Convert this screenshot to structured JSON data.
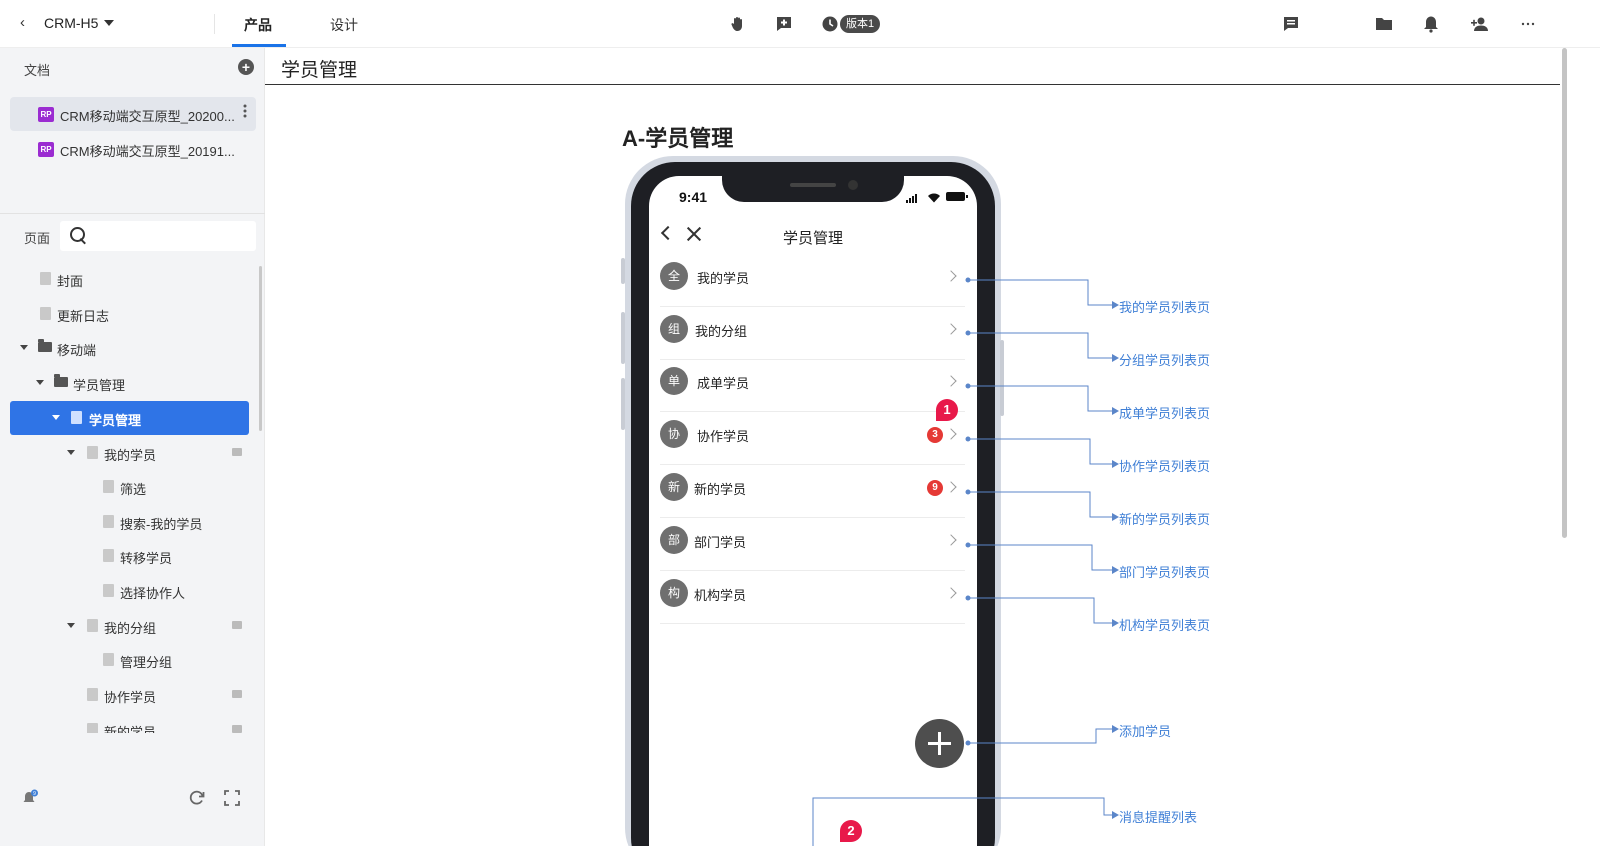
{
  "topbar": {
    "project_name": "CRM-H5",
    "tabs": [
      {
        "label": "产品"
      },
      {
        "label": "设计"
      }
    ],
    "version_badge": "版本1"
  },
  "sidebar": {
    "docs_label": "文档",
    "docs": [
      {
        "badge": "RP",
        "name": "CRM移动端交互原型_20200..."
      },
      {
        "badge": "RP",
        "name": "CRM移动端交互原型_20191..."
      }
    ],
    "pages_label": "页面",
    "search_placeholder": "",
    "tree": [
      {
        "label": "封面"
      },
      {
        "label": "更新日志"
      },
      {
        "label": "移动端"
      },
      {
        "label": "学员管理"
      },
      {
        "label": "学员管理"
      },
      {
        "label": "我的学员"
      },
      {
        "label": "筛选"
      },
      {
        "label": "搜索-我的学员"
      },
      {
        "label": "转移学员"
      },
      {
        "label": "选择协作人"
      },
      {
        "label": "我的分组"
      },
      {
        "label": "管理分组"
      },
      {
        "label": "协作学员"
      },
      {
        "label": "新的学员"
      }
    ],
    "notify_count": "9"
  },
  "canvas": {
    "page_title": "学员管理",
    "section_title": "A-学员管理",
    "phone": {
      "status_time": "9:41",
      "nav_title": "学员管理",
      "menu": [
        {
          "icon_char": "全",
          "label": "我的学员",
          "count": ""
        },
        {
          "icon_char": "组",
          "label": "我的分组",
          "count": ""
        },
        {
          "icon_char": "单",
          "label": "成单学员",
          "count": ""
        },
        {
          "icon_char": "协",
          "label": "协作学员",
          "count": "3"
        },
        {
          "icon_char": "新",
          "label": "新的学员",
          "count": "9"
        },
        {
          "icon_char": "部",
          "label": "部门学员",
          "count": ""
        },
        {
          "icon_char": "构",
          "label": "机构学员",
          "count": ""
        }
      ],
      "markers": [
        "1",
        "2"
      ]
    },
    "link_targets": [
      "我的学员列表页",
      "分组学员列表页",
      "成单学员列表页",
      "协作学员列表页",
      "新的学员列表页",
      "部门学员列表页",
      "机构学员列表页",
      "添加学员",
      "消息提醒列表"
    ]
  },
  "colors": {
    "accent": "#2f74e6",
    "link": "#3f7fd6",
    "badge_red": "#e53935",
    "marker": "#e8194a",
    "rp_badge": "#9b2cd1"
  }
}
